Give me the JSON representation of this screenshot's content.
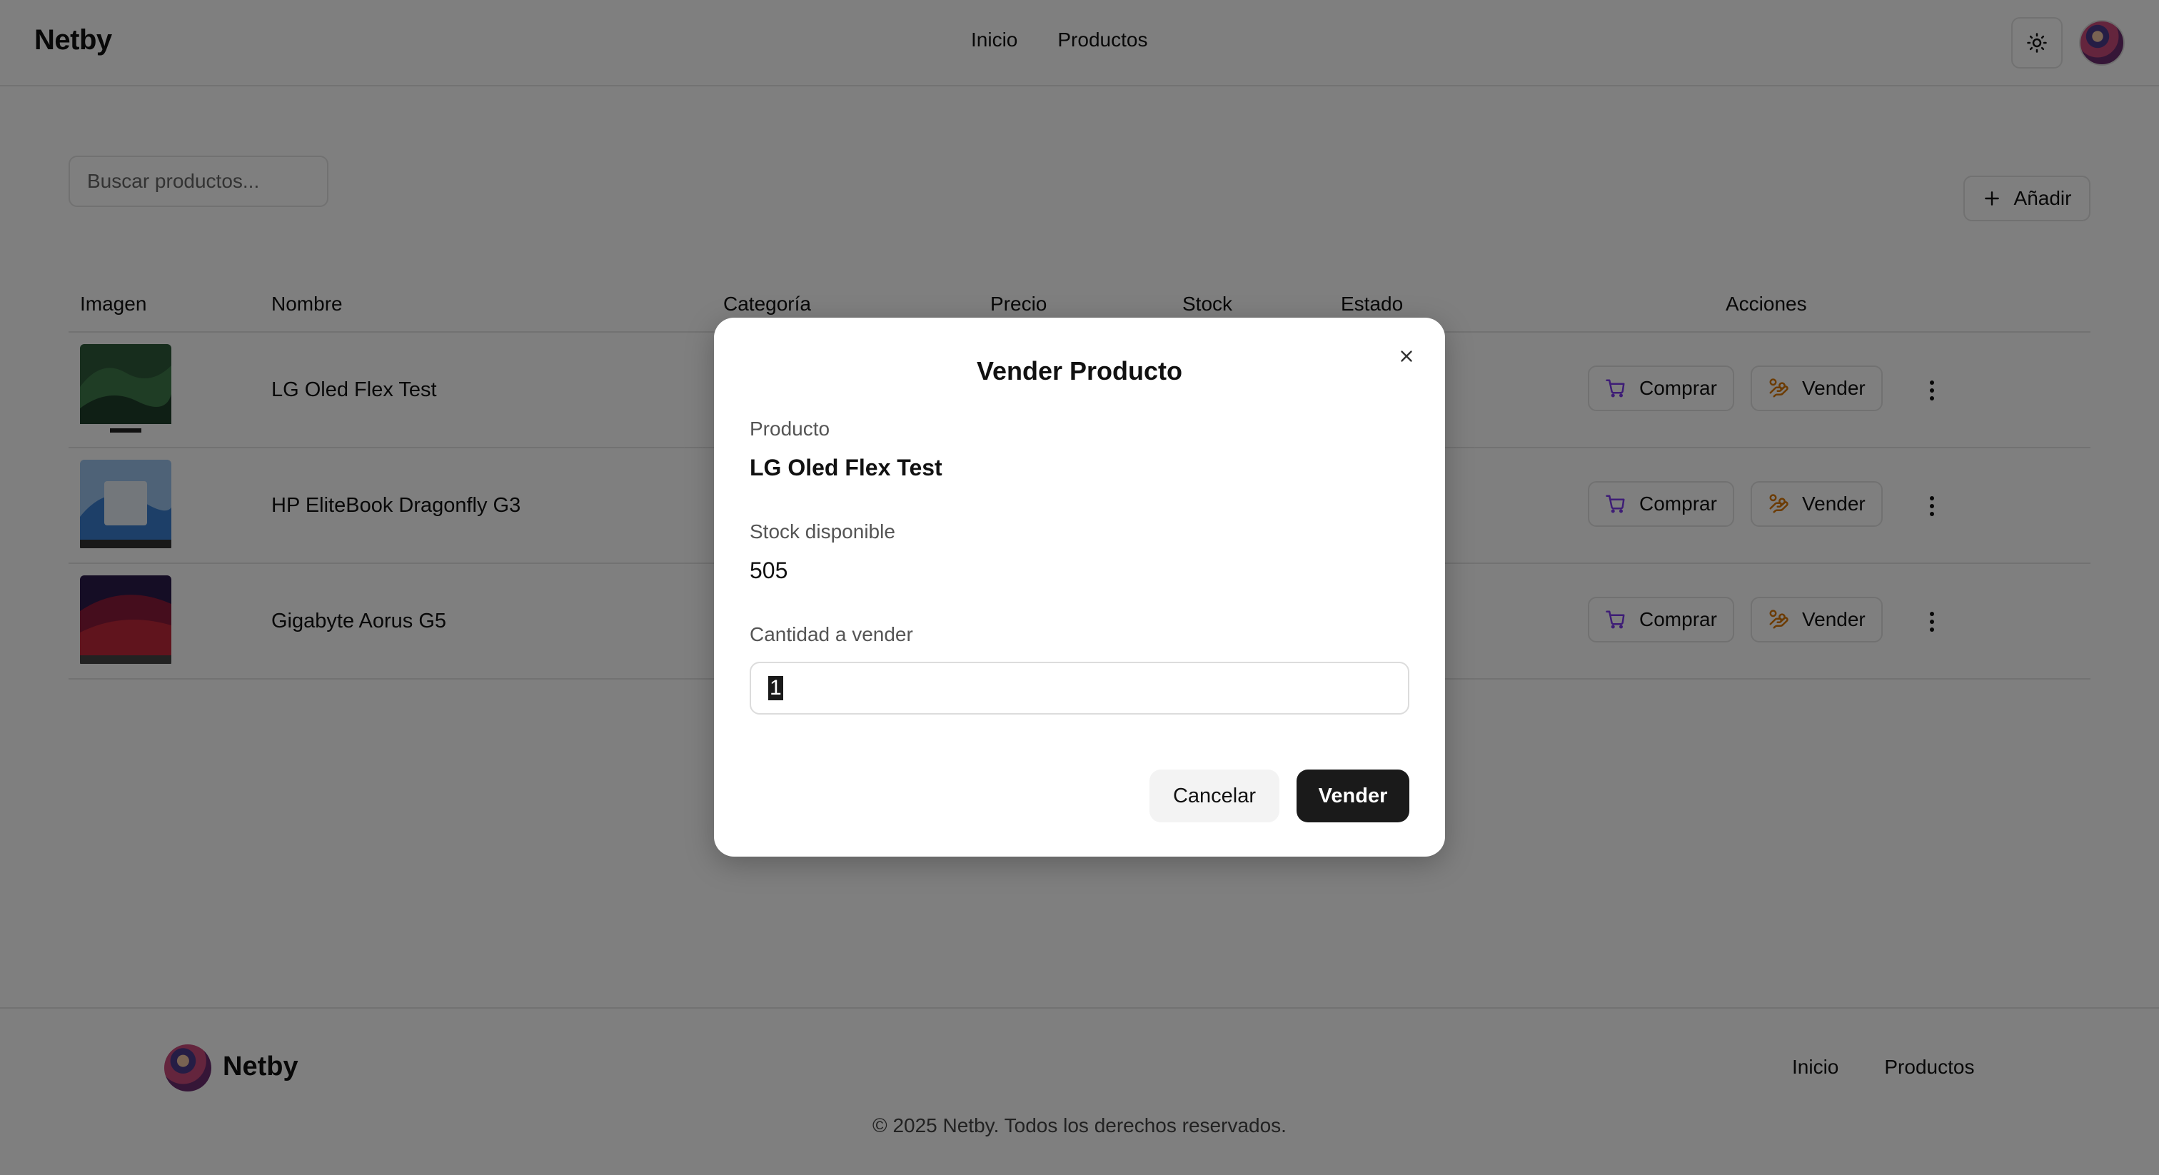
{
  "header": {
    "brand": "Netby",
    "nav": [
      "Inicio",
      "Productos"
    ]
  },
  "search": {
    "placeholder": "Buscar productos..."
  },
  "add_button": {
    "label": "Añadir"
  },
  "table": {
    "columns": [
      "Imagen",
      "Nombre",
      "Categoría",
      "Precio",
      "Stock",
      "Estado",
      "Acciones"
    ],
    "rows": [
      {
        "name": "LG Oled Flex Test",
        "thumb": "tv-landscape"
      },
      {
        "name": "HP EliteBook Dragonfly G3",
        "thumb": "laptop-windows"
      },
      {
        "name": "Gigabyte Aorus G5",
        "thumb": "laptop-red"
      }
    ],
    "actions": {
      "buy": "Comprar",
      "sell": "Vender"
    }
  },
  "modal": {
    "title": "Vender Producto",
    "product_label": "Producto",
    "product_value": "LG Oled Flex Test",
    "stock_label": "Stock disponible",
    "stock_value": "505",
    "quantity_label": "Cantidad a vender",
    "quantity_value": "1",
    "cancel": "Cancelar",
    "confirm": "Vender"
  },
  "footer": {
    "brand": "Netby",
    "nav": [
      "Inicio",
      "Productos"
    ],
    "copyright": "© 2025 Netby. Todos los derechos reservados."
  },
  "colors": {
    "buy_icon": "#7c3aed",
    "sell_icon": "#d97706",
    "primary": "#1a1a1a"
  }
}
